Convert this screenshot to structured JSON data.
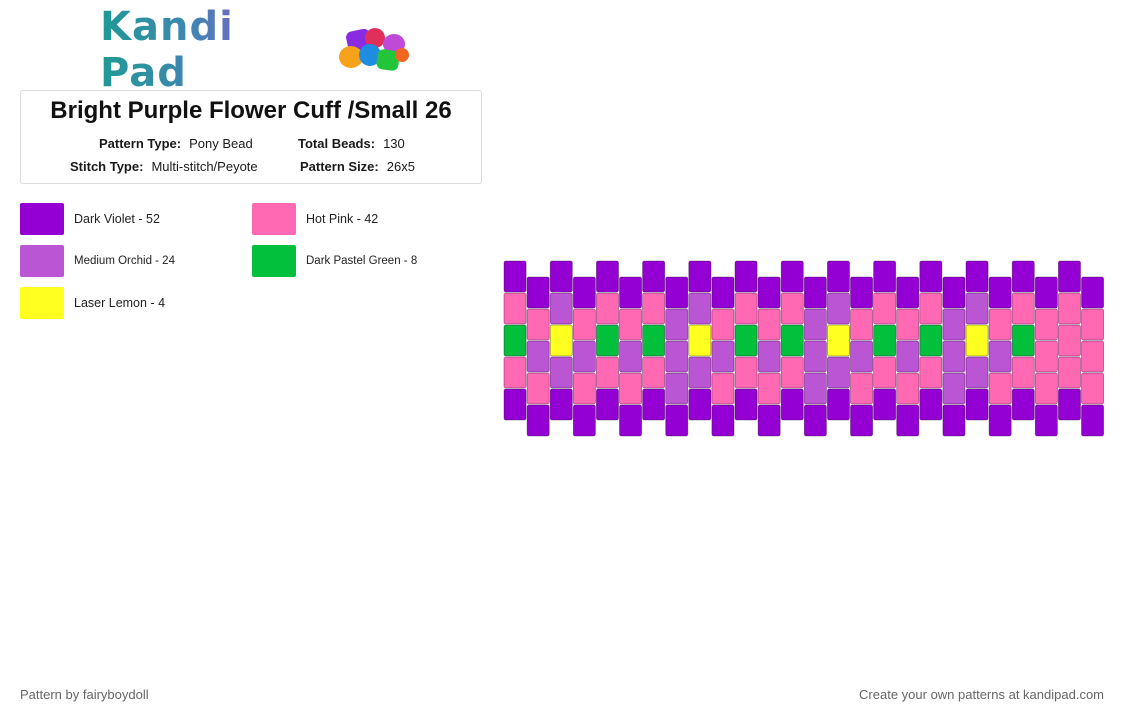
{
  "logo": {
    "text": "Kandi Pad"
  },
  "pattern": {
    "title": "Bright Purple Flower Cuff /Small 26",
    "fields": [
      {
        "label": "Pattern Type:",
        "value": "Pony Bead"
      },
      {
        "label": "Total Beads:",
        "value": "130"
      },
      {
        "label": "Stitch Type:",
        "value": "Multi-stitch/Peyote"
      },
      {
        "label": "Pattern Size:",
        "value": "26x5"
      }
    ]
  },
  "legend": [
    {
      "label": "Dark Violet - 52",
      "color": "#9400d3"
    },
    {
      "label": "Hot Pink - 42",
      "color": "#ff69b4"
    },
    {
      "label": "Medium Orchid - 24",
      "color": "#ba55d3"
    },
    {
      "label": "Dark Pastel Green - 8",
      "color": "#03c03c"
    },
    {
      "label": "Laser Lemon - 4",
      "color": "#ffff20"
    }
  ],
  "grid": {
    "columns": 26,
    "rows": 5,
    "palette": {
      "V": "#9400d3",
      "P": "#ff69b4",
      "O": "#ba55d3",
      "G": "#03c03c",
      "Y": "#ffff20"
    },
    "cells": [
      "VPGPV",
      "VPOPV",
      "VOYOV",
      "VPOPV",
      "VPGPV",
      "VPOPV",
      "VPGPV",
      "VOOOV",
      "VOYOV",
      "VPOPV",
      "VPGPV",
      "VPOPV",
      "VPGPV",
      "VOOOV",
      "VOYOV",
      "VPOPV",
      "VPGPV",
      "VPOPV",
      "VPGPV",
      "VOOOV",
      "VOYOV",
      "VPOPV",
      "VPGPV",
      "VPPPV",
      "VPPPV",
      "VPPPV"
    ]
  },
  "footer": {
    "left": "Pattern by fairyboydoll",
    "right": "Create your own patterns at kandipad.com"
  }
}
